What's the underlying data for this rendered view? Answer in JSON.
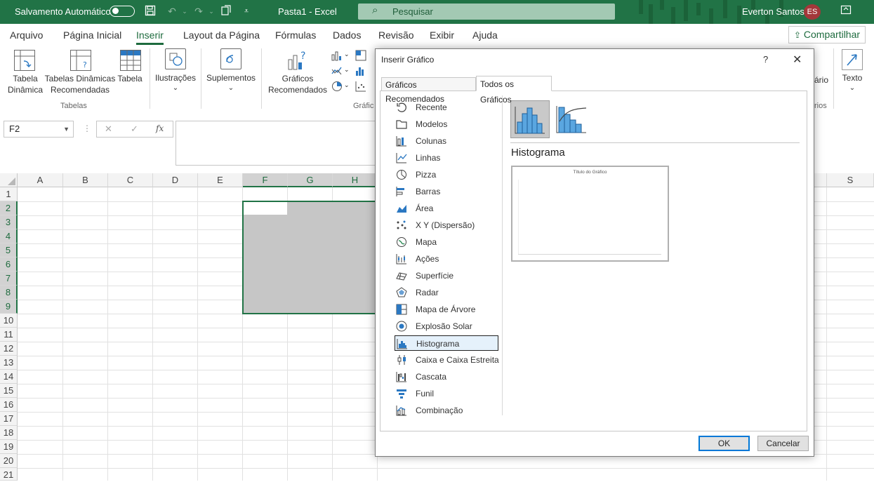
{
  "titlebar": {
    "autosave_label": "Salvamento Automático",
    "doc_title": "Pasta1  -  Excel",
    "search_placeholder": "Pesquisar",
    "user_name": "Everton Santos",
    "user_initials": "ES"
  },
  "menu": {
    "tabs": [
      "Arquivo",
      "Página Inicial",
      "Inserir",
      "Layout da Página",
      "Fórmulas",
      "Dados",
      "Revisão",
      "Exibir",
      "Ajuda"
    ],
    "active_tab": "Inserir",
    "share_label": "Compartilhar"
  },
  "ribbon": {
    "tabela_dinamica": "Tabela\nDinâmica",
    "tabelas_din_rec": "Tabelas Dinâmicas\nRecomendadas",
    "tabela": "Tabela",
    "group_tabelas": "Tabelas",
    "ilustracoes": "Ilustrações",
    "suplementos": "Suplementos",
    "graficos_recomendados": "Gráficos\nRecomendados",
    "group_graficos_partial": "Gráfic",
    "partial_rio": "ário",
    "partial_rios": "rios",
    "texto": "Texto"
  },
  "formula_bar": {
    "name_box": "F2",
    "fx": "fx"
  },
  "grid": {
    "columns": [
      "A",
      "B",
      "C",
      "D",
      "E",
      "F",
      "G",
      "H",
      "S"
    ],
    "rows": [
      "1",
      "2",
      "3",
      "4",
      "5",
      "6",
      "7",
      "8",
      "9",
      "10",
      "11",
      "12",
      "13",
      "14",
      "15",
      "16",
      "17",
      "18",
      "19",
      "20",
      "21"
    ]
  },
  "dialog": {
    "title": "Inserir Gráfico",
    "help": "?",
    "close": "✕",
    "tabs": [
      "Gráficos Recomendados",
      "Todos os Gráficos"
    ],
    "active_tab": "Todos os Gráficos",
    "chart_types": [
      "Recente",
      "Modelos",
      "Colunas",
      "Linhas",
      "Pizza",
      "Barras",
      "Área",
      "X Y (Dispersão)",
      "Mapa",
      "Ações",
      "Superfície",
      "Radar",
      "Mapa de Árvore",
      "Explosão Solar",
      "Histograma",
      "Caixa e Caixa Estreita",
      "Cascata",
      "Funil",
      "Combinação"
    ],
    "selected_type": "Histograma",
    "subtype_heading": "Histograma",
    "preview_title": "Título do Gráfico",
    "ok_label": "OK",
    "cancel_label": "Cancelar"
  },
  "colors": {
    "excel_green": "#217346",
    "selection_fill": "#c6c6c6",
    "accent_blue": "#0078d7"
  }
}
